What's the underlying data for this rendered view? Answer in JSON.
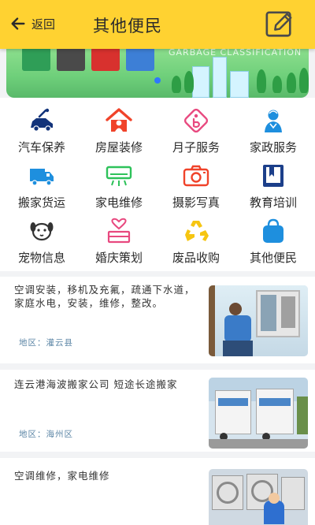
{
  "header": {
    "back_label": "返回",
    "title": "其他便民"
  },
  "banner": {
    "text": "GARBAGE CLASSIFICATION",
    "bin_colors": [
      "#2f9e57",
      "#4a4a4a",
      "#d8312e",
      "#3d7fd6"
    ]
  },
  "categories": [
    {
      "label": "汽车保养",
      "icon": "car-wash-icon"
    },
    {
      "label": "房屋装修",
      "icon": "house-repair-icon"
    },
    {
      "label": "月子服务",
      "icon": "baby-care-icon"
    },
    {
      "label": "家政服务",
      "icon": "housekeeper-icon"
    },
    {
      "label": "搬家货运",
      "icon": "moving-truck-icon"
    },
    {
      "label": "家电维修",
      "icon": "air-conditioner-icon"
    },
    {
      "label": "摄影写真",
      "icon": "camera-icon"
    },
    {
      "label": "教育培训",
      "icon": "book-icon"
    },
    {
      "label": "宠物信息",
      "icon": "pet-dog-icon"
    },
    {
      "label": "婚庆策划",
      "icon": "wedding-icon"
    },
    {
      "label": "废品收购",
      "icon": "recycle-icon"
    },
    {
      "label": "其他便民",
      "icon": "shopping-bag-icon"
    }
  ],
  "listings": [
    {
      "description": "空调安装，移机及充氟，疏通下水道，家庭水电，安装，维修，整改。",
      "region": "地区：灌云县",
      "thumbnail": "technician-installing-ac-photo"
    },
    {
      "description": "连云港海波搬家公司 短途长途搬家",
      "region": "地区：海州区",
      "thumbnail": "moving-trucks-photo"
    },
    {
      "description": "空调维修，家电维修",
      "region": "",
      "thumbnail": "ac-units-repair-photo"
    }
  ]
}
